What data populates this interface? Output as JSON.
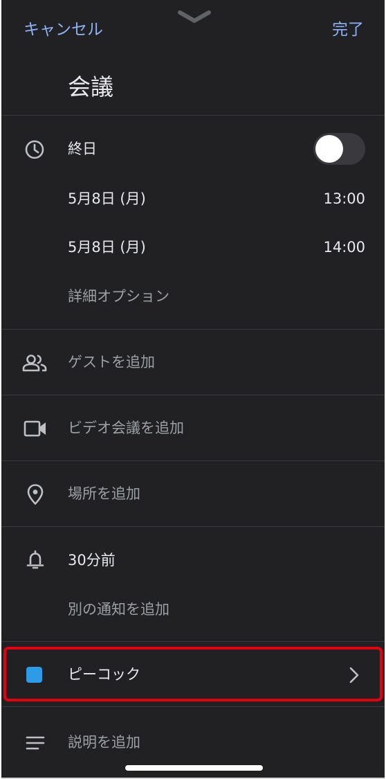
{
  "header": {
    "cancel_label": "キャンセル",
    "done_label": "完了"
  },
  "event": {
    "title": "会議"
  },
  "time": {
    "all_day_label": "終日",
    "all_day_on": false,
    "start_date": "5月8日 (月)",
    "start_time": "13:00",
    "end_date": "5月8日 (月)",
    "end_time": "14:00",
    "more_options_label": "詳細オプション"
  },
  "guests": {
    "label": "ゲストを追加",
    "icon": "people-icon"
  },
  "video": {
    "label": "ビデオ会議を追加",
    "icon": "videocam-icon"
  },
  "location": {
    "label": "場所を追加",
    "icon": "location-pin-icon"
  },
  "notifications": {
    "label": "30分前",
    "add_label": "別の通知を追加",
    "icon": "bell-icon"
  },
  "color": {
    "label": "ピーコック",
    "swatch": "#2e9be6",
    "highlight_border": "#e3000f"
  },
  "description": {
    "label": "説明を追加",
    "icon": "notes-icon"
  },
  "theme": {
    "background": "#212124",
    "accent": "#8ab4f8",
    "text": "#e8eaed",
    "muted_text": "#9aa0a6",
    "divider": "#3c3c40"
  }
}
